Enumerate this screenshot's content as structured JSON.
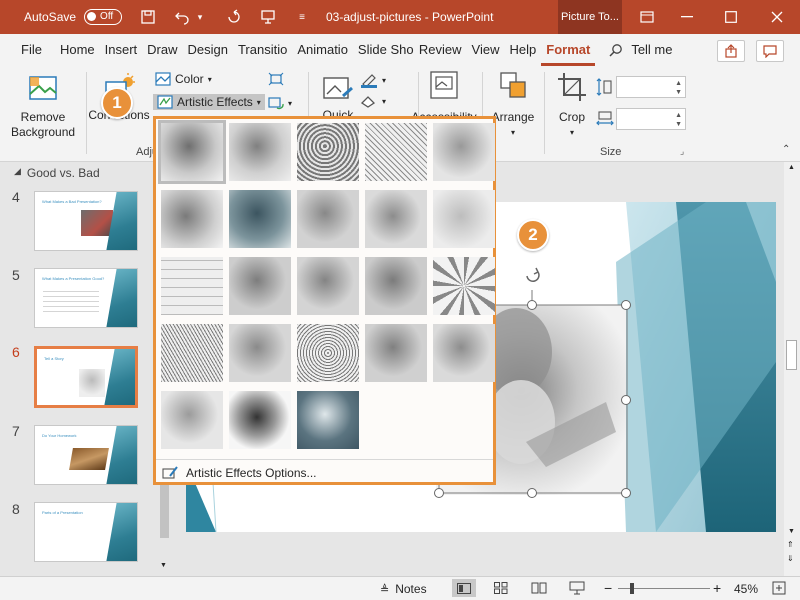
{
  "titlebar": {
    "autosave_label": "AutoSave",
    "autosave_state": "Off",
    "doc_title": "03-adjust-pictures - PowerPoint",
    "contextual_tab": "Picture To...",
    "colors": {
      "accent": "#b7472a"
    }
  },
  "tabs": [
    "File",
    "Home",
    "Insert",
    "Draw",
    "Design",
    "Transitio",
    "Animatio",
    "Slide Sho",
    "Review",
    "View",
    "Help",
    "Format"
  ],
  "active_tab": "Format",
  "tellme": "Tell me",
  "ribbon": {
    "remove_background": "Remove Background",
    "corrections": "Corrections",
    "color": "Color",
    "artistic_effects": "Artistic Effects",
    "adjust_group": "Adjust",
    "quick_styles": "Quick",
    "accessibility": "Accessibility",
    "arrange": "Arrange",
    "crop": "Crop",
    "size_group": "Size"
  },
  "slides_pane": {
    "section": "Good vs. Bad",
    "thumbs": [
      {
        "num": "4",
        "title": "What Makes a Bad Presentation?"
      },
      {
        "num": "5",
        "title": "What Makes a Presentation Good?"
      },
      {
        "num": "6",
        "title": "Tell a Story"
      },
      {
        "num": "7",
        "title": "Do Your Homework"
      },
      {
        "num": "8",
        "title": "Parts of a Presentation"
      }
    ],
    "selected": "6"
  },
  "gallery": {
    "footer": "Artistic Effects Options...",
    "item_count": 23
  },
  "callouts": {
    "one": "1",
    "two": "2"
  },
  "status": {
    "notes": "Notes",
    "zoom": "45%"
  }
}
